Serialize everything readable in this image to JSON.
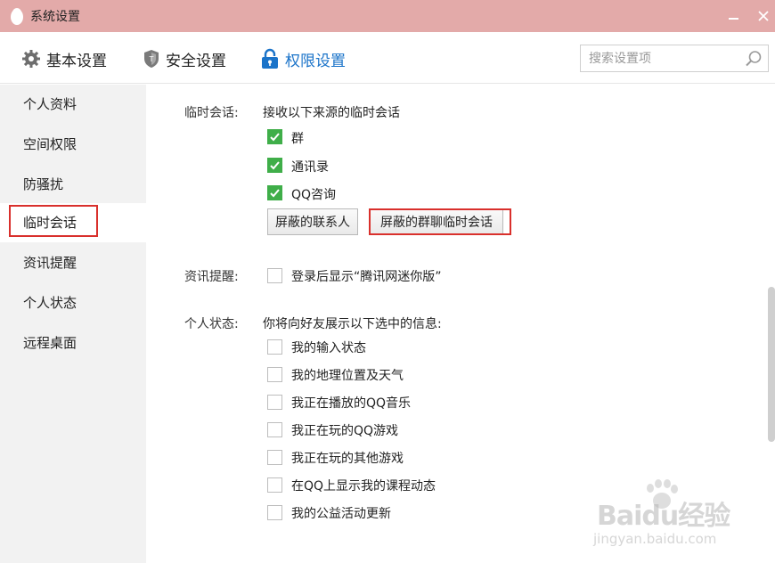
{
  "window": {
    "title": "系统设置"
  },
  "nav": {
    "tabs": [
      {
        "label": "基本设置",
        "icon": "gear-icon"
      },
      {
        "label": "安全设置",
        "icon": "shield-icon"
      },
      {
        "label": "权限设置",
        "icon": "lock-icon",
        "active": true
      }
    ],
    "search_placeholder": "搜索设置项"
  },
  "sidebar": {
    "items": [
      {
        "label": "个人资料"
      },
      {
        "label": "空间权限"
      },
      {
        "label": "防骚扰"
      },
      {
        "label": "临时会话",
        "active": true
      },
      {
        "label": "资讯提醒"
      },
      {
        "label": "个人状态"
      },
      {
        "label": "远程桌面"
      }
    ]
  },
  "temp_session": {
    "label": "临时会话:",
    "desc": "接收以下来源的临时会话",
    "options": [
      {
        "label": "群",
        "checked": true
      },
      {
        "label": "通讯录",
        "checked": true
      },
      {
        "label": "QQ咨询",
        "checked": true
      }
    ],
    "buttons": {
      "blocked_contacts": "屏蔽的联系人",
      "blocked_group_sessions": "屏蔽的群聊临时会话"
    }
  },
  "news": {
    "label": "资讯提醒:",
    "option": {
      "label": "登录后显示“腾讯网迷你版”",
      "checked": false
    }
  },
  "status": {
    "label": "个人状态:",
    "desc": "你将向好友展示以下选中的信息:",
    "options": [
      {
        "label": "我的输入状态",
        "checked": false
      },
      {
        "label": "我的地理位置及天气",
        "checked": false
      },
      {
        "label": "我正在播放的QQ音乐",
        "checked": false
      },
      {
        "label": "我正在玩的QQ游戏",
        "checked": false
      },
      {
        "label": "我正在玩的其他游戏",
        "checked": false
      },
      {
        "label": "在QQ上显示我的课程动态",
        "checked": false
      },
      {
        "label": "我的公益活动更新",
        "checked": false
      }
    ]
  },
  "watermark": {
    "brand": "Baidu经验",
    "url": "jingyan.baidu.com"
  },
  "colors": {
    "accent": "#1a73c9",
    "titlebar": "#e3aaa9",
    "check": "#3fae49",
    "highlight": "#d9302c"
  }
}
